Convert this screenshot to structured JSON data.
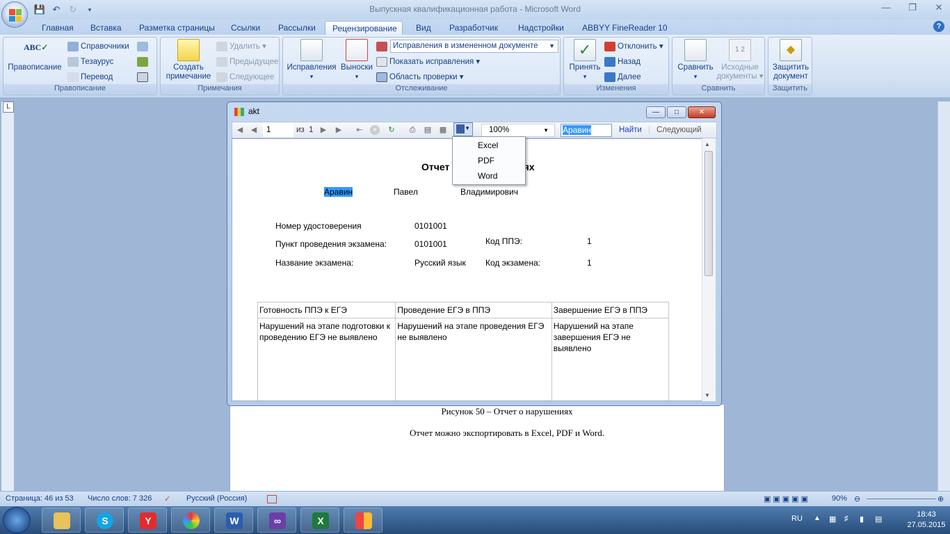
{
  "window": {
    "title": "Выпускная квалификационная работа - Microsoft Word"
  },
  "ribbon_tabs": [
    "Главная",
    "Вставка",
    "Разметка страницы",
    "Ссылки",
    "Рассылки",
    "Рецензирование",
    "Вид",
    "Разработчик",
    "Надстройки",
    "ABBYY FineReader 10"
  ],
  "active_tab": "Рецензирование",
  "groups": {
    "proofing": {
      "caption": "Правописание",
      "spelling": "Правописание",
      "research": "Справочники",
      "thesaurus": "Тезаурус",
      "translate": "Перевод"
    },
    "comments": {
      "caption": "Примечания",
      "new_line1": "Создать",
      "new_line2": "примечание",
      "delete": "Удалить",
      "previous": "Предыдущее",
      "next": "Следующее"
    },
    "tracking": {
      "caption": "Отслеживание",
      "track_changes": "Исправления",
      "balloons": "Выноски",
      "display_for_review": "Исправления в измененном документе",
      "show_markup": "Показать исправления",
      "reviewing_pane": "Область проверки"
    },
    "changes": {
      "caption": "Изменения",
      "accept": "Принять",
      "reject": "Отклонить",
      "previous": "Назад",
      "next": "Далее"
    },
    "compare": {
      "caption": "Сравнить",
      "compare": "Сравнить",
      "source_line1": "Исходные",
      "source_line2": "документы"
    },
    "protect": {
      "caption": "Защитить",
      "protect_line1": "Защитить",
      "protect_line2": "документ"
    }
  },
  "document": {
    "caption": "Рисунок 50 – Отчет о нарушениях",
    "paragraph": "Отчет можно экспортировать в Excel, PDF и Word."
  },
  "status": {
    "page": "Страница: 46 из 53",
    "words": "Число слов: 7 326",
    "language": "Русский (Россия)",
    "zoom": "90%"
  },
  "tray": {
    "lang": "RU",
    "time": "18:43",
    "date": "27.05.2015"
  },
  "dialog": {
    "title": "akt",
    "toolbar": {
      "page": "1",
      "of": "из",
      "total": "1",
      "zoom": "100%",
      "find_text": "Аравин",
      "find": "Найти",
      "next": "Следующий"
    },
    "export_menu": [
      "Excel",
      "PDF",
      "Word"
    ],
    "report": {
      "title_left": "Отчет",
      "title_right": "иях",
      "surname": "Аравин",
      "name": "Павел",
      "patronymic": "Владимирович",
      "cert_label": "Номер удостоверения",
      "cert_value": "0101001",
      "point_label": "Пункт проведения экзамена:",
      "point_value": "0101001",
      "exam_label": "Название экзамена:",
      "exam_value": "Русский язык",
      "ppe_code_label": "Код ППЭ:",
      "ppe_code_value": "1",
      "exam_code_label": "Код экзамена:",
      "exam_code_value": "1",
      "table_headers": [
        "Готовность ППЭ к ЕГЭ",
        "Проведение ЕГЭ в ППЭ",
        "Завершение ЕГЭ в ППЭ"
      ],
      "table_row": [
        "Нарушений на этапе подготовки к проведению ЕГЭ не выявлено",
        "Нарушений на этапе проведения ЕГЭ не выявлено",
        "Нарушений на этапе завершения ЕГЭ не выявлено"
      ]
    }
  },
  "colors": {
    "ribbon_text": "#15428b",
    "highlight": "#3399ff",
    "link": "#1a3fc4"
  }
}
